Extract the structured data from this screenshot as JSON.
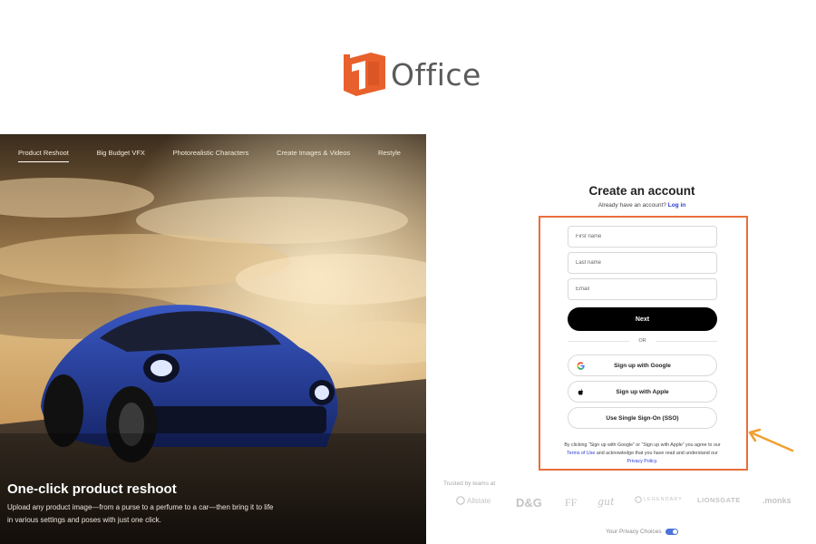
{
  "brand": {
    "name": "Office",
    "color": "#e8612c"
  },
  "hero": {
    "nav": [
      {
        "label": "Product Reshoot",
        "active": true
      },
      {
        "label": "Big Budget VFX",
        "active": false
      },
      {
        "label": "Photorealistic Characters",
        "active": false
      },
      {
        "label": "Create Images & Videos",
        "active": false
      },
      {
        "label": "Restyle",
        "active": false
      }
    ],
    "headline": "One-click product reshoot",
    "subtext": "Upload any product image—from a purse to a perfume to a car—then bring it to life in various settings and poses with just one click."
  },
  "form": {
    "title": "Create an account",
    "subtitle": "Already have an account?",
    "login_link": "Log in",
    "first_name": {
      "placeholder": "First name",
      "value": ""
    },
    "last_name": {
      "placeholder": "Last name",
      "value": ""
    },
    "email": {
      "placeholder": "Email",
      "value": ""
    },
    "next_label": "Next",
    "or_label": "OR",
    "google_label": "Sign up with Google",
    "apple_label": "Sign up with Apple",
    "sso_label": "Use Single Sign-On (SSO)",
    "legal": {
      "prefix": "By clicking “Sign up with Google” or “Sign up with Apple” you agree to our",
      "terms": "Terms of Use",
      "middle": "and acknowledge that you have read and understand our",
      "privacy": "Privacy Policy",
      "suffix": "."
    },
    "highlight_color": "#e86f3b"
  },
  "trusted": {
    "label": "Trusted by teams at",
    "brands": [
      "Allstate",
      "D&G",
      "FF",
      "gut",
      "LEGENDARY",
      "LIONSGATE",
      ".monks"
    ]
  },
  "footer": {
    "privacy_choices": "Your Privacy Choices"
  }
}
